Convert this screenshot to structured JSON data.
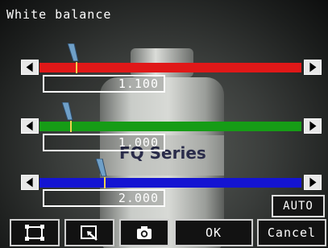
{
  "title": "White balance",
  "sliders": [
    {
      "channel": "red",
      "value": "1.100",
      "level": 0.14
    },
    {
      "channel": "green",
      "value": "1.000",
      "level": 0.12
    },
    {
      "channel": "blue",
      "value": "2.000",
      "level": 0.25
    }
  ],
  "auto_label": "AUTO",
  "toolbar": {
    "ok_label": "OK",
    "cancel_label": "Cancel",
    "icons": [
      "frame-icon",
      "zoom-icon",
      "camera-icon"
    ]
  },
  "background_text": "FQ Series",
  "colors": {
    "red": "#e01818",
    "green": "#169c16",
    "blue": "#1414d2",
    "marker": "#f0d050",
    "thumb": "#6fa0c8"
  }
}
